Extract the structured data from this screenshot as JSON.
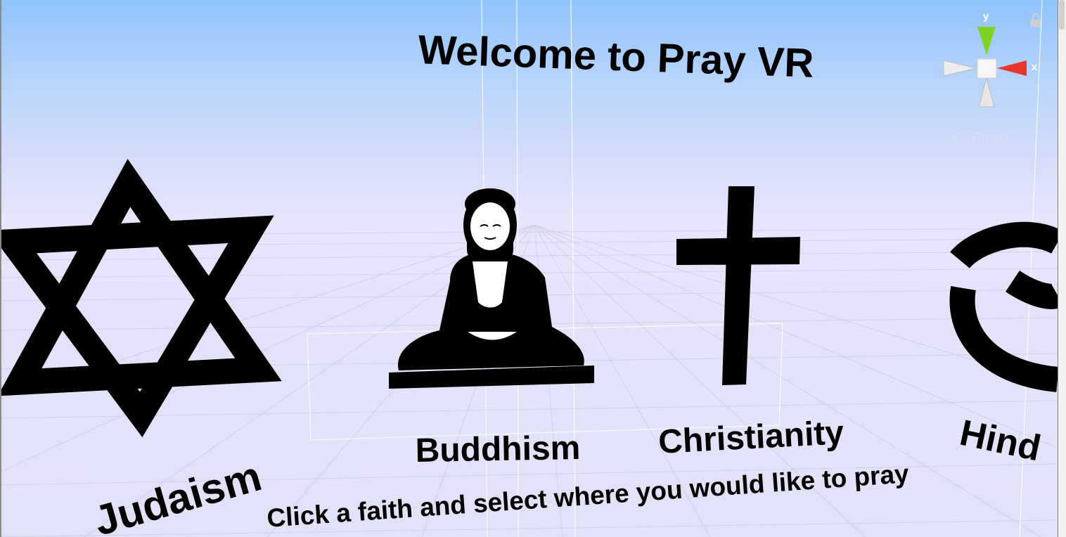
{
  "scene": {
    "title": "Welcome to Pray VR",
    "instruction": "Click a faith and select where you would like to pray",
    "faiths": [
      {
        "label": "Judaism",
        "icon": "star-of-david-icon"
      },
      {
        "label": "Buddhism",
        "icon": "buddha-icon"
      },
      {
        "label": "Christianity",
        "icon": "cross-icon"
      },
      {
        "label": "Hind",
        "icon": "om-icon"
      }
    ]
  },
  "gizmo": {
    "y_label": "y",
    "x_label": "x",
    "projection_label": "Persp",
    "colors": {
      "y_axis": "#7ed321",
      "x_axis": "#e8372a",
      "neutral": "#d9d9d9"
    }
  }
}
